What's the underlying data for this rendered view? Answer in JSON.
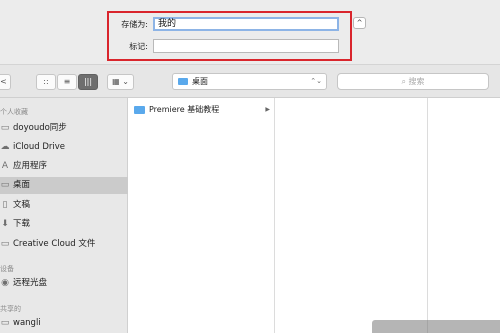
{
  "save": {
    "name_label": "存储为:",
    "name_value": "我的",
    "tags_label": "标记:",
    "tags_value": "",
    "expand_symbol": "^"
  },
  "toolbar": {
    "back_symbol": "<",
    "icon_view_symbol": "::",
    "list_view_symbol": "≡",
    "column_view_symbol": "|||",
    "arrange_symbol": "▦ ⌄",
    "location": "桌面",
    "location_updown": "⌃⌄",
    "search_placeholder": "搜索"
  },
  "sidebar": {
    "favorites_header": "个人收藏",
    "items": [
      {
        "label": "doyoudo同步",
        "icon": "folder-icon",
        "selected": false
      },
      {
        "label": "iCloud Drive",
        "icon": "cloud-icon",
        "selected": false
      },
      {
        "label": "应用程序",
        "icon": "applications-icon",
        "selected": false
      },
      {
        "label": "桌面",
        "icon": "desktop-icon",
        "selected": true
      },
      {
        "label": "文稿",
        "icon": "documents-icon",
        "selected": false
      },
      {
        "label": "下载",
        "icon": "download-icon",
        "selected": false
      },
      {
        "label": "Creative Cloud 文件",
        "icon": "folder-icon",
        "selected": false
      }
    ],
    "devices_header": "设备",
    "devices": [
      {
        "label": "远程光盘",
        "icon": "disc-icon"
      }
    ],
    "shared_header": "共享的",
    "shared": [
      {
        "label": "wangli",
        "icon": "computer-icon"
      }
    ]
  },
  "browser": {
    "column1": [
      {
        "label": "Premiere 基础教程",
        "icon": "folder-icon",
        "has_children": true
      }
    ]
  },
  "colors": {
    "highlight_box": "#d9252c",
    "folder_blue": "#5aa9ec",
    "selection": "#cbcbcb"
  }
}
